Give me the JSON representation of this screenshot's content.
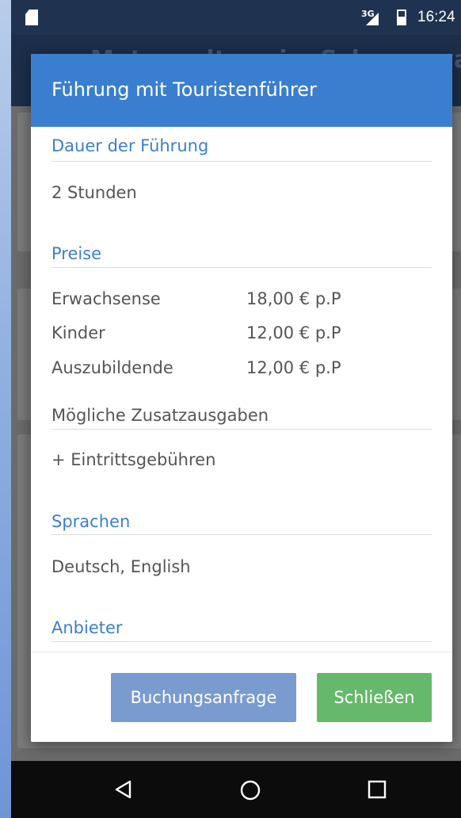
{
  "status_bar": {
    "network": "3G",
    "time": "16:24"
  },
  "app_bar": {
    "title": "Motorradtour im Schwarzwald"
  },
  "dialog": {
    "title": "Führung mit Touristenführer",
    "sections": {
      "duration": {
        "heading": "Dauer der Führung",
        "value": "2 Stunden"
      },
      "prices": {
        "heading": "Preise",
        "rows": [
          {
            "label": "Erwachsense",
            "value": "18,00 € p.P"
          },
          {
            "label": "Kinder",
            "value": "12,00 € p.P"
          },
          {
            "label": "Auszubildende",
            "value": "12,00 € p.P"
          }
        ]
      },
      "extras": {
        "heading": "Mögliche Zusatzausgaben",
        "value": "+ Eintrittsgebühren"
      },
      "languages": {
        "heading": "Sprachen",
        "value": "Deutsch, English"
      },
      "provider": {
        "heading": "Anbieter"
      }
    },
    "buttons": {
      "request": "Buchungsanfrage",
      "close": "Schließen"
    }
  },
  "colors": {
    "header": "#3a7fcf",
    "heading_text": "#3c7fcc",
    "request_button": "#7a9bd0",
    "close_button": "#66b96a"
  },
  "icons": {
    "nav_back": "back-triangle-icon",
    "nav_home": "home-circle-icon",
    "nav_recent": "recent-square-icon"
  }
}
